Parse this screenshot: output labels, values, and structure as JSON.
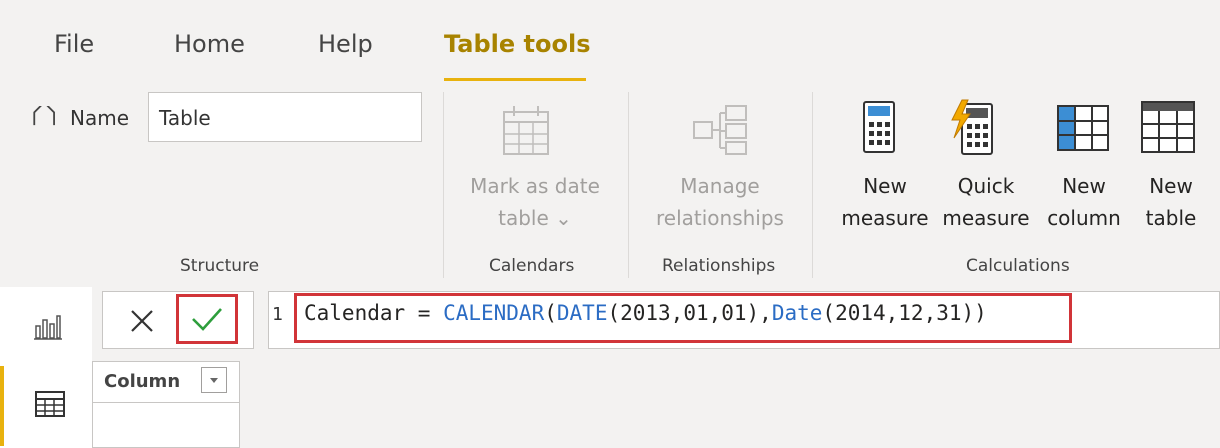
{
  "tabs": [
    "File",
    "Home",
    "Help",
    "Table tools"
  ],
  "structure": {
    "name_label": "Name",
    "name_value": "Table",
    "group_label": "Structure"
  },
  "calendars": {
    "mark_line1": "Mark as date",
    "mark_line2": "table ⌄",
    "group_label": "Calendars"
  },
  "relationships": {
    "manage_line1": "Manage",
    "manage_line2": "relationships",
    "group_label": "Relationships"
  },
  "calculations": {
    "new_measure_line1": "New",
    "new_measure_line2": "measure",
    "quick_measure_line1": "Quick",
    "quick_measure_line2": "measure",
    "new_column_line1": "New",
    "new_column_line2": "column",
    "new_table_line1": "New",
    "new_table_line2": "table",
    "group_label": "Calculations"
  },
  "formula": {
    "line_number": "1",
    "part1": "Calendar = ",
    "fn1": "CALENDAR",
    "part2": "(",
    "fn2": "DATE",
    "part3": "(2013,01,01),",
    "fn3": "Date",
    "part4": "(2014,12,31))"
  },
  "table": {
    "column_header": "Column"
  },
  "colors": {
    "accent": "#e8b20e",
    "highlight_border": "#d13438",
    "keyword": "#2b6cc4",
    "confirm_check": "#2e9e3c"
  }
}
